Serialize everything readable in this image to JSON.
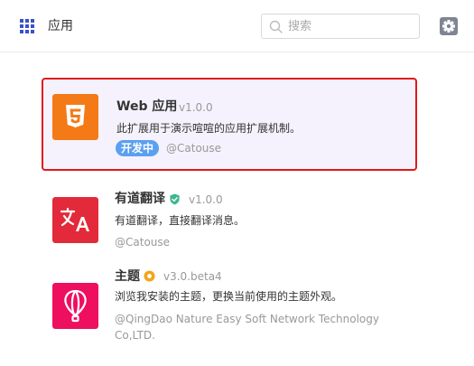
{
  "header": {
    "title": "应用",
    "search_placeholder": "搜索",
    "icons": [
      "grid-icon",
      "search-icon",
      "gear-icon"
    ]
  },
  "apps": [
    {
      "name": "Web 应用",
      "version": "v1.0.0",
      "description": "此扩展用于演示喧喧的应用扩展机制。",
      "badge": "开发中",
      "author": "@Catouse",
      "icon": "html5-icon",
      "icon_color": "#f47a17"
    },
    {
      "name": "有道翻译",
      "version": "v1.0.0",
      "description": "有道翻译，直接翻译消息。",
      "author": "@Catouse",
      "icon": "translate-icon",
      "icon_color": "#e22a3a",
      "verified_badge_color": "#3cb88a"
    },
    {
      "name": "主题",
      "version": "v3.0.beta4",
      "description": "浏览我安装的主题，更换当前使用的主题外观。",
      "author_line1": "@QingDao Nature Easy Soft Network Technology",
      "author_line2": "Co,LTD.",
      "icon": "balloon-icon",
      "icon_color": "#ee0f5e",
      "official_badge_color": "#f3a41b"
    }
  ],
  "colors": {
    "accent": "#3a52c4",
    "selected_border": "#e0191c",
    "selected_bg": "#f5f2fd",
    "badge_bg": "#5aa0f0"
  }
}
